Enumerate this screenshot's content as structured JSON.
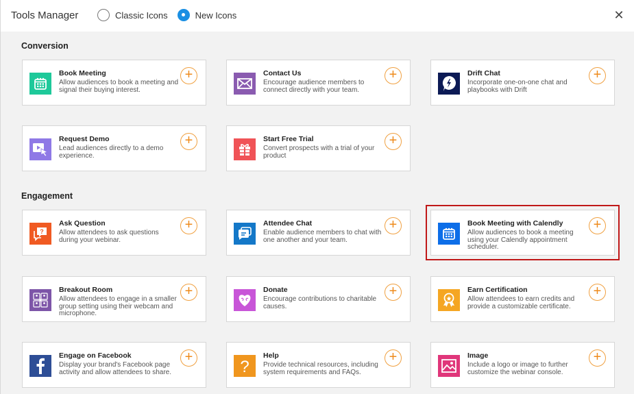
{
  "window": {
    "title": "Tools Manager",
    "icon_style": {
      "options": [
        {
          "label": "Classic Icons",
          "selected": false
        },
        {
          "label": "New Icons",
          "selected": true
        }
      ]
    },
    "close_icon": "close-icon"
  },
  "accent_colors": {
    "radio_selected": "#1a8fe3",
    "add_button": "#ee8a1a",
    "highlight_border": "#c01818"
  },
  "sections": [
    {
      "title": "Conversion",
      "tools": [
        {
          "name": "Book Meeting",
          "description": "Allow audiences to book a meeting and signal their buying interest.",
          "icon": "calendar-icon",
          "color": "#1ec99a"
        },
        {
          "name": "Contact Us",
          "description": "Encourage audience members to connect directly with your team.",
          "icon": "envelope-icon",
          "color": "#8a5bb0"
        },
        {
          "name": "Drift Chat",
          "description": "Incorporate one-on-one chat and playbooks with Drift",
          "icon": "drift-logo-icon",
          "color": "#0c1a55"
        },
        {
          "name": "Request Demo",
          "description": "Lead audiences directly to a demo experience.",
          "icon": "video-cursor-icon",
          "color": "#8f79e6"
        },
        {
          "name": "Start Free Trial",
          "description": "Convert prospects with a trial of your product",
          "icon": "gift-icon",
          "color": "#f05357"
        }
      ]
    },
    {
      "title": "Engagement",
      "tools": [
        {
          "name": "Ask Question",
          "description": "Allow attendees to ask questions during your webinar.",
          "icon": "question-bubble-icon",
          "color": "#f05a22"
        },
        {
          "name": "Attendee Chat",
          "description": "Enable audience members to chat with one another and your team.",
          "icon": "chat-bubbles-icon",
          "color": "#1478c8"
        },
        {
          "name": "Book Meeting with Calendly",
          "description": "Allow audiences to book a meeting using your Calendly appointment scheduler.",
          "icon": "calendar-icon",
          "color": "#0d6ee8",
          "highlighted": true
        },
        {
          "name": "Breakout Room",
          "description": "Allow attendees to engage in a smaller group setting using their webcam and microphone.",
          "icon": "group-grid-icon",
          "color": "#7d55a8"
        },
        {
          "name": "Donate",
          "description": "Encourage contributions to charitable causes.",
          "icon": "heart-icon",
          "color": "#c855d8"
        },
        {
          "name": "Earn Certification",
          "description": "Allow attendees to earn credits and provide a customizable certificate.",
          "icon": "award-ribbon-icon",
          "color": "#f5a623"
        },
        {
          "name": "Engage on Facebook",
          "description": "Display your brand's Facebook page activity and allow attendees to share.",
          "icon": "facebook-icon",
          "color": "#2e4e96"
        },
        {
          "name": "Help",
          "description": "Provide technical resources, including system requirements and FAQs.",
          "icon": "question-mark-icon",
          "color": "#f0961e"
        },
        {
          "name": "Image",
          "description": "Include a logo or image to further customize the webinar console.",
          "icon": "image-icon",
          "color": "#e0367a"
        }
      ]
    }
  ]
}
